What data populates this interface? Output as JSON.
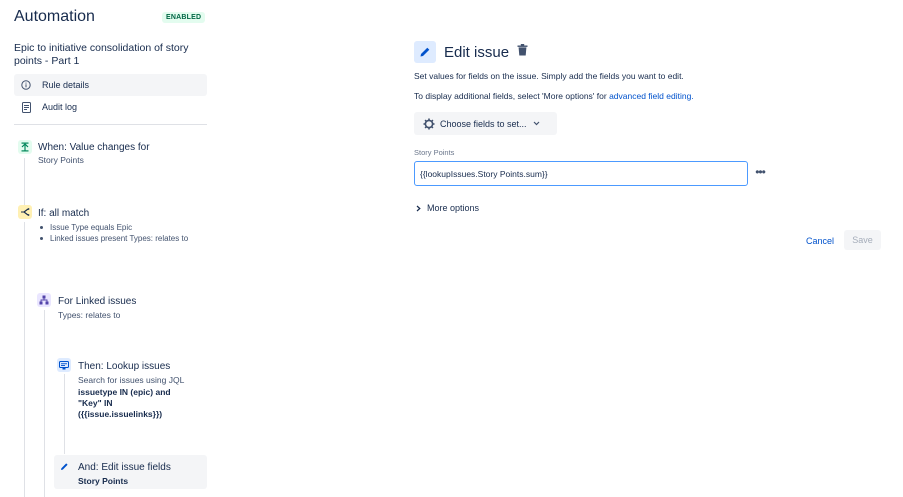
{
  "sidebar": {
    "app_title": "Automation",
    "status_badge": "ENABLED",
    "rule_name": "Epic to initiative consolidation of story points - Part 1",
    "nav": [
      {
        "label": "Rule details",
        "icon": "info-icon"
      },
      {
        "label": "Audit log",
        "icon": "document-icon"
      }
    ],
    "steps": {
      "trigger": {
        "title": "When: Value changes for",
        "detail": "Story Points",
        "icon": "trigger-icon"
      },
      "condition": {
        "title": "If: all match",
        "bullets": [
          "Issue Type equals Epic",
          "Linked issues present Types: relates to"
        ],
        "icon": "branch-condition-icon"
      },
      "branch": {
        "title": "For Linked issues",
        "detail": "Types: relates to",
        "icon": "hierarchy-icon"
      },
      "lookup": {
        "title": "Then: Lookup issues",
        "detail": "Search for issues using JQL",
        "jql_bold": "issuetype IN (epic) and \"Key\" IN ({{issue.issuelinks}})",
        "icon": "lookup-icon"
      },
      "edit": {
        "title": "And: Edit issue fields",
        "detail_bold": "Story Points",
        "icon": "pencil-icon"
      }
    }
  },
  "main": {
    "title": "Edit issue",
    "description1": "Set values for fields on the issue. Simply add the fields you want to edit.",
    "description2_prefix": "To display additional fields, select 'More options' for ",
    "description2_link": "advanced field editing.",
    "choose_fields_label": "Choose fields to set...",
    "field_label": "Story Points",
    "field_value": "{{lookupIssues.Story Points.sum}}",
    "more_options_label": "More options",
    "cancel_label": "Cancel",
    "save_label": "Save"
  },
  "colors": {
    "accent": "#0052cc",
    "badge_bg": "#e3fcef",
    "badge_text": "#006644",
    "trigger_icon_bg": "#e3fcef",
    "condition_icon_bg": "#fff0b3",
    "branch_icon_bg": "#eae6ff",
    "action_icon_bg": "#deebff"
  }
}
